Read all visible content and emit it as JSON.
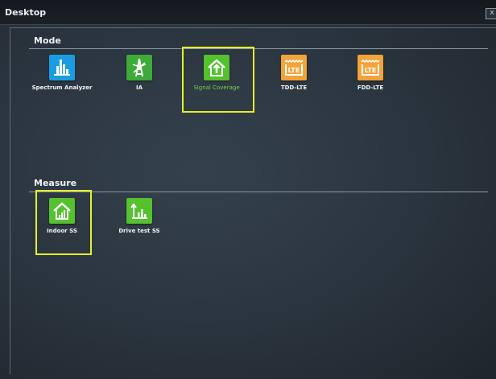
{
  "window": {
    "title": "Desktop",
    "close_label": "x"
  },
  "mode": {
    "heading": "Mode",
    "apps": [
      {
        "label": "Spectrum Analyzer",
        "icon": "spectrum-icon",
        "color": "#1a9de0"
      },
      {
        "label": "IA",
        "icon": "interference-icon",
        "color": "#3eaa3a"
      },
      {
        "label": "Signal Coverage",
        "icon": "house-up-icon",
        "color": "#55c12f",
        "selected": true
      },
      {
        "label": "TDD-LTE",
        "icon": "lte-icon",
        "color": "#f2a33a"
      },
      {
        "label": "FDD-LTE",
        "icon": "lte-icon",
        "color": "#f2a33a"
      }
    ]
  },
  "measure": {
    "heading": "Measure",
    "apps": [
      {
        "label": "Indoor SS",
        "icon": "indoor-house-icon",
        "color": "#55c12f",
        "selected": true
      },
      {
        "label": "Drive test SS",
        "icon": "drive-test-icon",
        "color": "#55c12f"
      }
    ]
  },
  "colors": {
    "highlight": "#e4ef2a",
    "background": "#2a343e"
  }
}
